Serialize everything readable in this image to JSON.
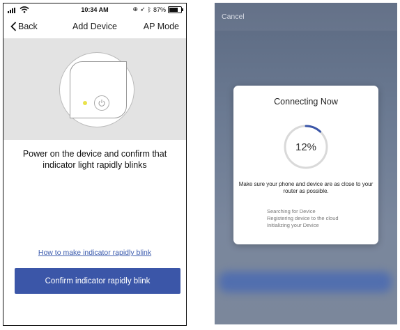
{
  "left": {
    "status": {
      "time": "10:34 AM",
      "battery": "87%",
      "battery_level": 0.87
    },
    "nav": {
      "back": "Back",
      "title": "Add Device",
      "right": "AP Mode"
    },
    "instruction": "Power on the device and confirm that indicator light rapidly blinks",
    "help_link": "How to make indicator rapidly blink",
    "confirm_button": "Confirm indicator rapidly blink",
    "colors": {
      "accent": "#3b56a8",
      "link": "#3a5aad",
      "led": "#e9e24a",
      "hero_bg": "#e3e3e3"
    }
  },
  "right": {
    "cancel": "Cancel",
    "modal": {
      "title": "Connecting Now",
      "progress_label": "12%",
      "progress_value": 12,
      "hint": "Make sure your phone and device are as close to your router as possible.",
      "steps": [
        "Searching for Device",
        "Registering device to the cloud",
        "Initializing your Device"
      ]
    },
    "colors": {
      "progress": "#3b56a8",
      "track": "#d9d9d9"
    }
  }
}
